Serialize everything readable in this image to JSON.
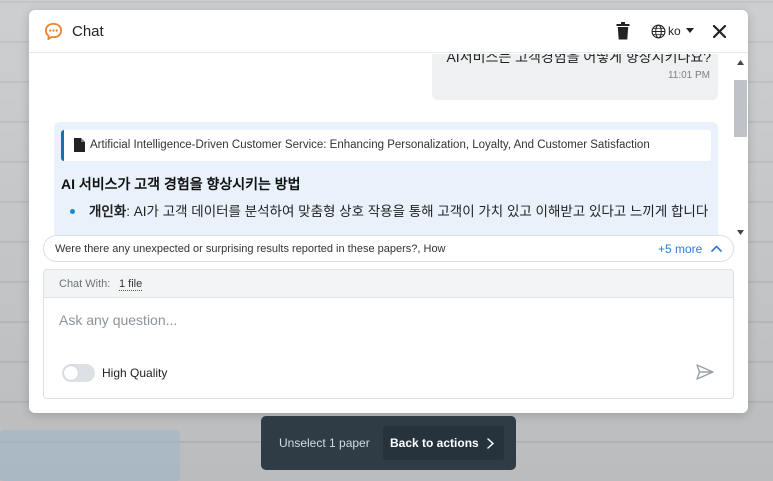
{
  "header": {
    "title": "Chat",
    "language": "ko"
  },
  "messages": {
    "user": {
      "text": "AI서비스는 고객경험을 어떻게 향상시키나요?",
      "time": "11:01 PM"
    },
    "ai": {
      "source_title": "Artificial Intelligence-Driven Customer Service: Enhancing Personalization, Loyalty, And Customer Satisfaction",
      "heading": "AI 서비스가 고객 경험을 향상시키는 방법",
      "bullets": [
        {
          "label": "개인화",
          "text": ": AI가 고객 데이터를 분석하여 맞춤형 상호 작용을 통해 고객이 가치 있고 이해받고 있다고 느끼게 합니다"
        }
      ]
    }
  },
  "suggestions": {
    "text": "Were there any unexpected or surprising results reported in these papers?, How",
    "more": "+5 more"
  },
  "input": {
    "chat_with_label": "Chat With:",
    "chat_with_value": "1 file",
    "placeholder": "Ask any question...",
    "quality_label": "High Quality",
    "high_quality_on": false
  },
  "actions": {
    "unselect": "Unselect 1 paper",
    "back": "Back to actions"
  },
  "colors": {
    "accent": "#f0822e",
    "link": "#2b7bd6",
    "source_border": "#1c6fa8",
    "ai_bubble": "#e9f2fb",
    "action_bar": "#2f3b45"
  },
  "icons": [
    "chat-logo-icon",
    "trash-icon",
    "globe-icon",
    "caret-down-icon",
    "close-icon",
    "doc-icon",
    "chevron-up-icon",
    "send-icon",
    "chevron-right-icon"
  ]
}
